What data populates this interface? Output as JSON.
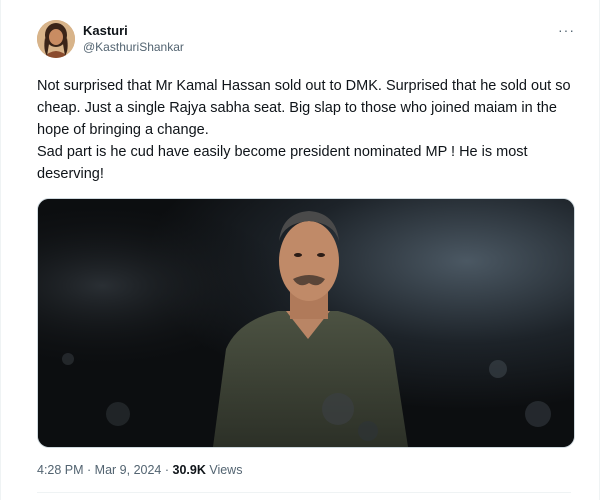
{
  "author": {
    "display_name": "Kasturi",
    "handle": "@KasthuriShankar"
  },
  "more_icon": "more-horizontal-icon",
  "tweet_text": "Not surprised that Mr Kamal Hassan  sold out to DMK. Surprised that he sold out so cheap. Just a single Rajya sabha seat. Big slap to those who joined maiam in the hope of bringing a change.\nSad part is he cud have easily become president nominated MP ! He  is most deserving!",
  "meta": {
    "time": "4:28 PM",
    "separator1": " · ",
    "date": "Mar 9, 2024",
    "separator2": " · ",
    "views_count": "30.9K",
    "views_label": " Views"
  },
  "colors": {
    "text": "#0f1419",
    "secondary": "#536471",
    "divider": "#eff3f4"
  }
}
